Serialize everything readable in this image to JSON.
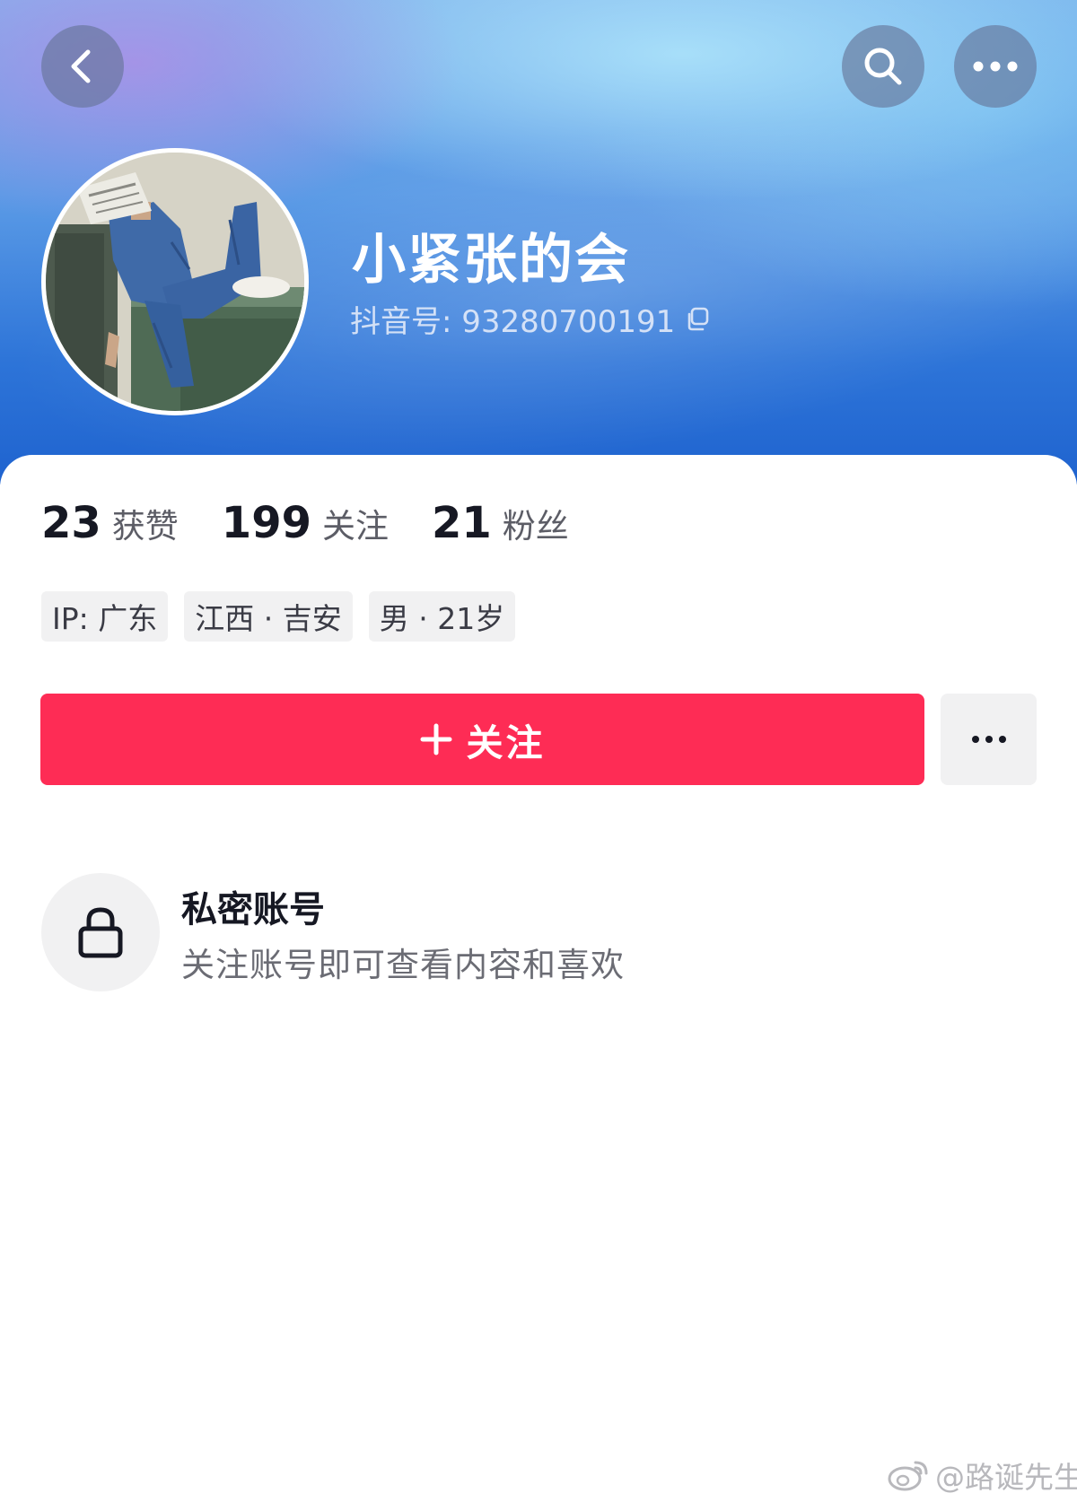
{
  "header": {
    "username": "小紧张的会",
    "douyin_id": "抖音号: 93280700191"
  },
  "stats": [
    {
      "value": "23",
      "label": "获赞"
    },
    {
      "value": "199",
      "label": "关注"
    },
    {
      "value": "21",
      "label": "粉丝"
    }
  ],
  "tags": [
    "IP: 广东",
    "江西 · 吉安",
    "男 · 21岁"
  ],
  "actions": {
    "follow_label": "关注"
  },
  "private_account": {
    "title": "私密账号",
    "description": "关注账号即可查看内容和喜欢"
  },
  "watermark": "@路诞先生",
  "colors": {
    "accent": "#fe2c55",
    "banner_blue": "#2d74d8",
    "secondary_bg": "#f1f1f2",
    "text_primary": "#161823"
  },
  "icons": [
    "back-icon",
    "search-icon",
    "more-icon",
    "copy-icon",
    "plus-icon",
    "ellipsis-icon",
    "lock-icon",
    "weibo-icon"
  ]
}
